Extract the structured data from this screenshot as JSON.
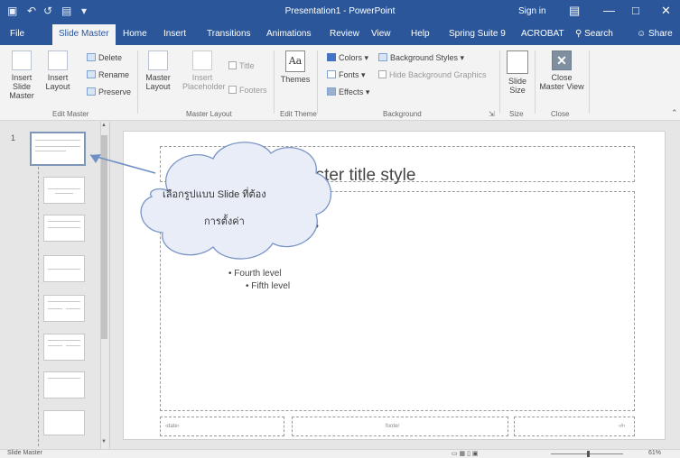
{
  "titlebar": {
    "title": "Presentation1 - PowerPoint",
    "signin": "Sign in",
    "icons": [
      "save-icon",
      "undo-icon",
      "redo-icon",
      "start-from-beginning-icon",
      "customize-quick-access-icon"
    ]
  },
  "tabs": [
    "File",
    "Slide Master",
    "Home",
    "Insert",
    "Transitions",
    "Animations",
    "Review",
    "View",
    "Help",
    "Spring Suite 9",
    "ACROBAT",
    "Search",
    "Share"
  ],
  "ribbon": {
    "edit_master": {
      "insert_slide_master": "Insert Slide Master",
      "insert_layout": "Insert Layout",
      "delete": "Delete",
      "rename": "Rename",
      "preserve": "Preserve",
      "label": "Edit Master"
    },
    "master_layout": {
      "master_layout": "Master Layout",
      "insert_placeholder": "Insert Placeholder",
      "title": "Title",
      "footers": "Footers",
      "label": "Master Layout"
    },
    "edit_theme": {
      "themes": "Themes",
      "label": "Edit Theme"
    },
    "background": {
      "colors": "Colors",
      "fonts": "Fonts",
      "effects": "Effects",
      "background_styles": "Background Styles",
      "hide_background": "Hide Background Graphics",
      "label": "Background"
    },
    "size": {
      "slide_size": "Slide Size",
      "label": "Size"
    },
    "close": {
      "close_master_view": "Close Master View",
      "label": "Close"
    }
  },
  "thumbnails": {
    "number": "1"
  },
  "slide": {
    "title": "aster title style",
    "fragment": "s",
    "level4": "• Fourth level",
    "level5": "• Fifth level"
  },
  "callout": {
    "line1": "เลือกรูปแบบ Slide ที่ต้อง",
    "line2": "การตั้งค่า"
  },
  "status": {
    "view": "Slide Master",
    "zoom": "61%"
  },
  "colors": {
    "accent": "#2b579a",
    "ribbon": "#f3f3f3",
    "workspace": "#e6e6e6"
  }
}
